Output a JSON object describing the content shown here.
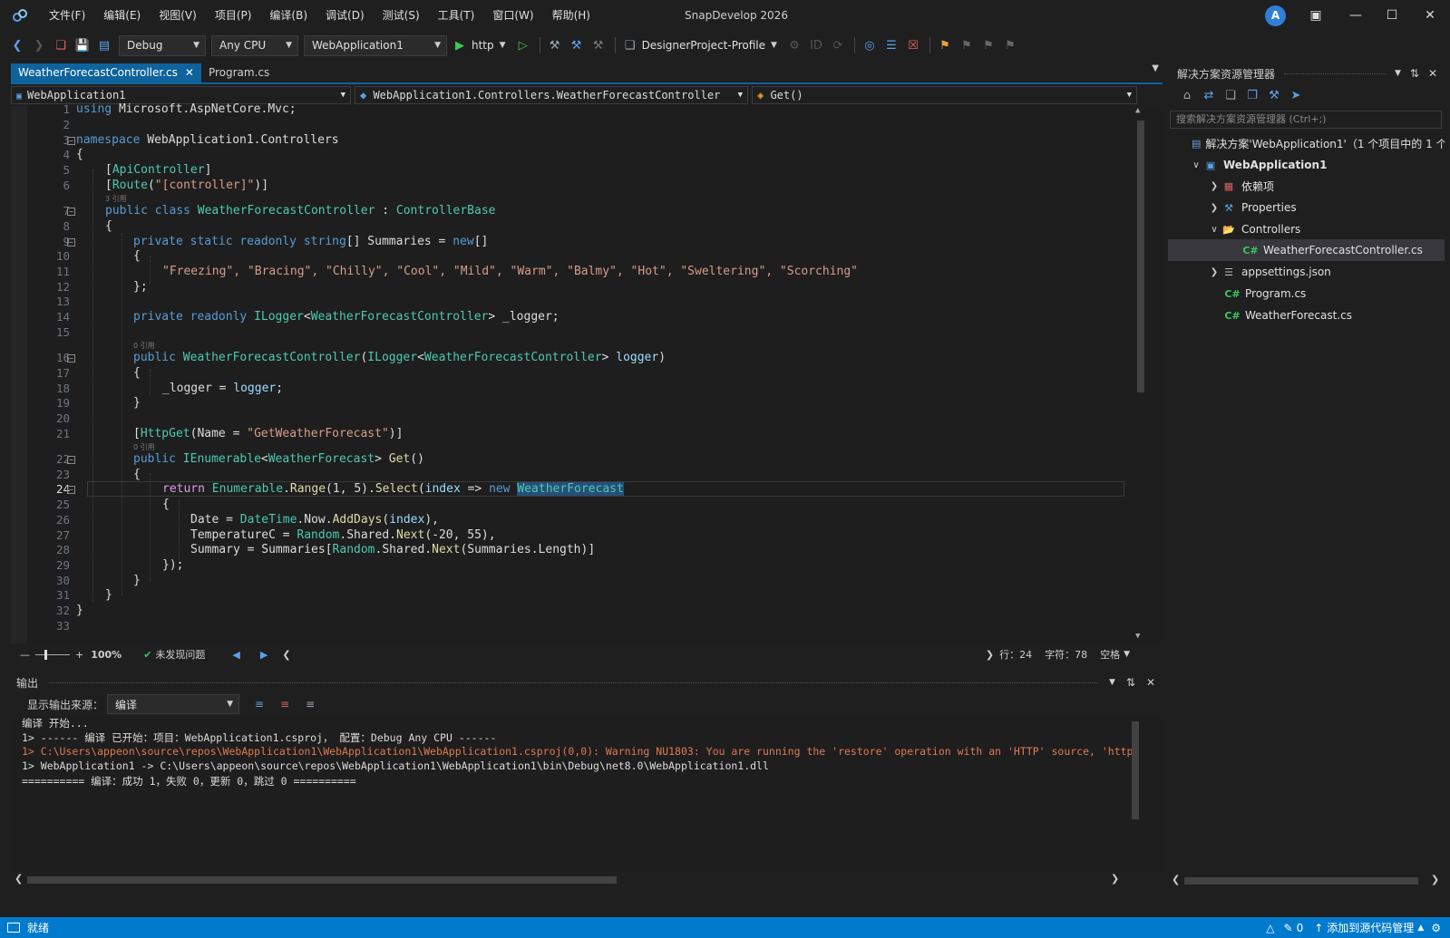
{
  "app_title": "SnapDevelop 2026",
  "menu": [
    "文件(F)",
    "编辑(E)",
    "视图(V)",
    "项目(P)",
    "编译(B)",
    "调试(D)",
    "测试(S)",
    "工具(T)",
    "窗口(W)",
    "帮助(H)"
  ],
  "avatar_letter": "A",
  "toolbar": {
    "config": "Debug",
    "platform": "Any CPU",
    "project": "WebApplication1",
    "run_label": "http",
    "profile": "DesignerProject-Profile"
  },
  "tabs": [
    {
      "label": "WeatherForecastController.cs"
    },
    {
      "label": "Program.cs"
    }
  ],
  "nav": {
    "project": "WebApplication1",
    "class": "WebApplication1.Controllers.WeatherForecastController",
    "member": "Get()"
  },
  "hints": {
    "h1": "3 引用",
    "h2": "0 引用",
    "h3": "0 引用"
  },
  "code": {
    "l1": "using Microsoft.AspNetCore.Mvc;",
    "l3": "namespace WebApplication1.Controllers",
    "l4": "{",
    "l5": "[ApiController]",
    "l6": "[Route(\"[controller]\")]",
    "l7": "public class WeatherForecastController : ControllerBase",
    "l8": "{",
    "l9": "private static readonly string[] Summaries = new[]",
    "l10": "{",
    "l11": "\"Freezing\", \"Bracing\", \"Chilly\", \"Cool\", \"Mild\", \"Warm\", \"Balmy\", \"Hot\", \"Sweltering\", \"Scorching\"",
    "l12": "};",
    "l14": "private readonly ILogger<WeatherForecastController> _logger;",
    "l16": "public WeatherForecastController(ILogger<WeatherForecastController> logger)",
    "l17": "{",
    "l18": "_logger = logger;",
    "l19": "}",
    "l21": "[HttpGet(Name = \"GetWeatherForecast\")]",
    "l22": "public IEnumerable<WeatherForecast> Get()",
    "l23": "{",
    "l24": "return Enumerable.Range(1, 5).Select(index => new WeatherForecast",
    "l25": "{",
    "l26": "Date = DateTime.Now.AddDays(index),",
    "l27": "TemperatureC = Random.Shared.Next(-20, 55),",
    "l28": "Summary = Summaries[Random.Shared.Next(Summaries.Length)]",
    "l29": "});",
    "l30": "}",
    "l31": "}",
    "l32": "}"
  },
  "editor_status": {
    "zoom": "100%",
    "issues": "未发现问题",
    "line": "行：24",
    "col": "字符：78",
    "spaces": "空格"
  },
  "output": {
    "title": "输出",
    "source_label": "显示输出来源：",
    "source_value": "编译",
    "lines": [
      "编译 开始...",
      "1> ------ 编译 已开始：项目：WebApplication1.csproj， 配置：Debug Any CPU ------",
      "1> C:\\Users\\appeon\\source\\repos\\WebApplication1\\WebApplication1\\WebApplication1.csproj(0,0): Warning NU1803: You are running the 'restore' operation with an 'HTTP' source, 'http",
      "1> WebApplication1 -> C:\\Users\\appeon\\source\\repos\\WebApplication1\\WebApplication1\\bin\\Debug\\net8.0\\WebApplication1.dll",
      "========== 编译：成功 1，失败 0，更新 0，跳过 0 =========="
    ]
  },
  "solution_explorer": {
    "title": "解决方案资源管理器",
    "search_placeholder": "搜索解决方案资源管理器 (Ctrl+;)",
    "items": [
      {
        "label": "解决方案'WebApplication1'（1 个项目中的 1 个"
      },
      {
        "label": "WebApplication1"
      },
      {
        "label": "依赖项"
      },
      {
        "label": "Properties"
      },
      {
        "label": "Controllers"
      },
      {
        "label": "WeatherForecastController.cs"
      },
      {
        "label": "appsettings.json"
      },
      {
        "label": "Program.cs"
      },
      {
        "label": "WeatherForecast.cs"
      }
    ]
  },
  "statusbar": {
    "left": "就绪",
    "errors": "0",
    "source_control": "添加到源代码管理"
  },
  "colors": {
    "accent": "#007acc",
    "tab_active": "#0e639c",
    "keyword": "#569cd6",
    "type": "#4ec9b0",
    "string": "#d69d85",
    "warning": "#e07a4f"
  }
}
